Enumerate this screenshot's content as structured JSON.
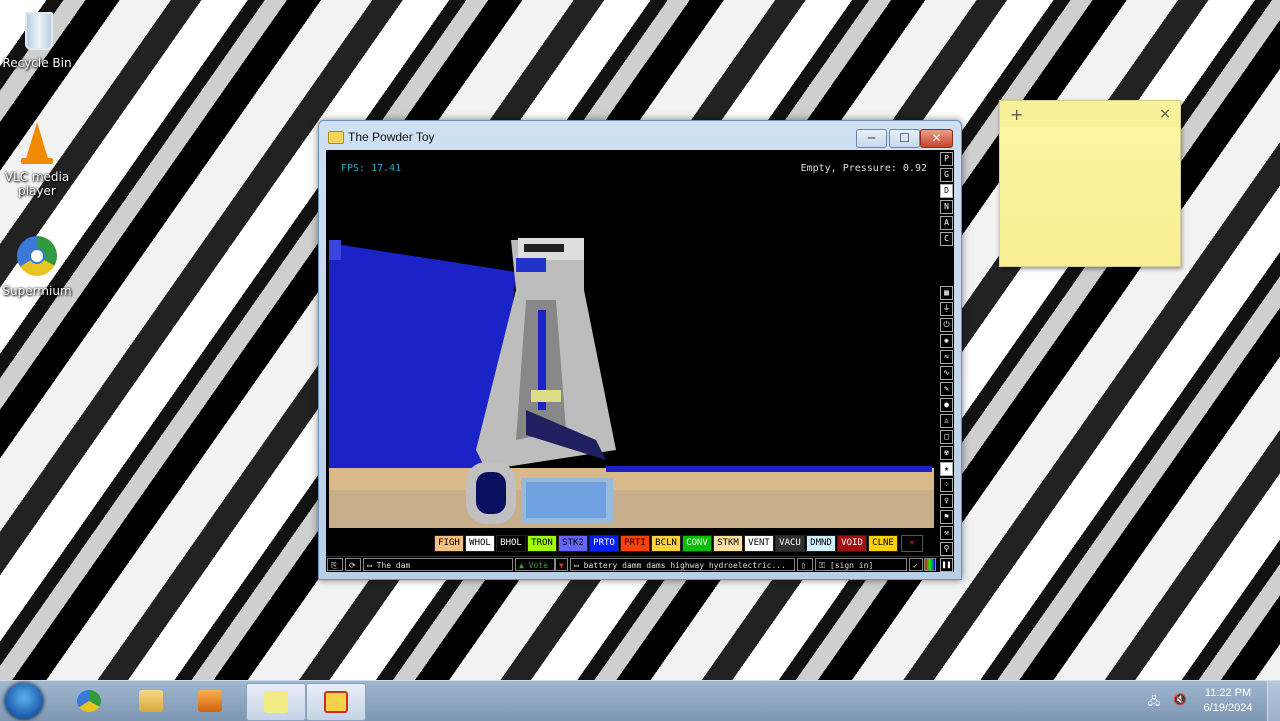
{
  "desktop": {
    "icons": [
      {
        "label": "Recycle Bin",
        "icon": "recycle-bin-icon"
      },
      {
        "label": "VLC media player",
        "icon": "vlc-cone-icon"
      },
      {
        "label": "Supermium",
        "icon": "browser-icon"
      }
    ]
  },
  "window": {
    "title": "The Powder Toy",
    "buttons": {
      "minimize": "─",
      "maximize": "☐",
      "close": "✕"
    }
  },
  "sim": {
    "fps": "FPS: 17.41",
    "status": "Empty, Pressure: 0.92"
  },
  "right_menu": {
    "top": [
      "P",
      "G",
      "D",
      "N",
      "A",
      "C"
    ],
    "tools": [
      "wall-icon",
      "plug-icon",
      "power-icon",
      "explosive-icon",
      "gas-icon",
      "liquid-icon",
      "pen-icon",
      "drop-icon",
      "person-icon",
      "square-icon",
      "radioactive-icon",
      "star-icon",
      "dots-icon",
      "bulb-icon",
      "flag-icon",
      "wrench-icon",
      "magnifier-icon"
    ]
  },
  "elements": [
    {
      "label": "FIGH",
      "bg": "#f4c080",
      "fg": "#000000"
    },
    {
      "label": "WHOL",
      "bg": "#ffffff",
      "fg": "#000000"
    },
    {
      "label": "BHOL",
      "bg": "#000000",
      "fg": "#ffffff"
    },
    {
      "label": "TRON",
      "bg": "#a0ff00",
      "fg": "#000000"
    },
    {
      "label": "STK2",
      "bg": "#6464ff",
      "fg": "#000000"
    },
    {
      "label": "PRTO",
      "bg": "#0020ff",
      "fg": "#ffffff"
    },
    {
      "label": "PRTI",
      "bg": "#ff4000",
      "fg": "#000000"
    },
    {
      "label": "BCLN",
      "bg": "#ffd040",
      "fg": "#000000"
    },
    {
      "label": "CONV",
      "bg": "#00c000",
      "fg": "#ffffff"
    },
    {
      "label": "STKM",
      "bg": "#ffe0a0",
      "fg": "#000000"
    },
    {
      "label": "VENT",
      "bg": "#ffffff",
      "fg": "#000000"
    },
    {
      "label": "VACU",
      "bg": "#303030",
      "fg": "#ffffff"
    },
    {
      "label": "DMND",
      "bg": "#d0f0ff",
      "fg": "#000000"
    },
    {
      "label": "VOID",
      "bg": "#a01010",
      "fg": "#ffffff"
    },
    {
      "label": "CLNE",
      "bg": "#ffd000",
      "fg": "#000000"
    }
  ],
  "bottom_bar": {
    "save_title": "The dam",
    "vote": "Vote",
    "tags": "battery damm dams highway hydroelectric...",
    "login": "[sign in]"
  },
  "sticky_note": {
    "add": "+",
    "close": "×"
  },
  "taskbar": {
    "time": "11:22 PM",
    "date": "6/19/2024",
    "apps": [
      "browser-icon",
      "file-explorer-icon",
      "media-player-icon",
      "sticky-notes-icon",
      "powder-toy-icon"
    ]
  }
}
